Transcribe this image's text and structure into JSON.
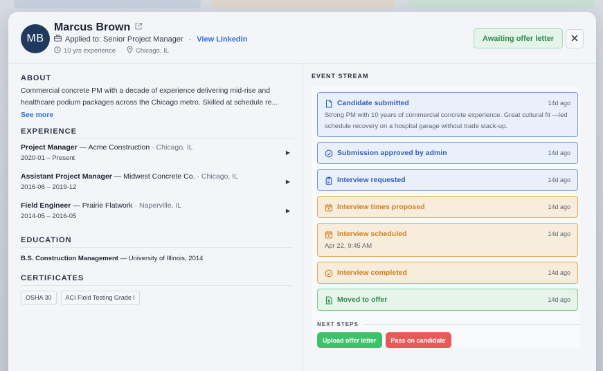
{
  "candidate": {
    "initials": "MB",
    "name": "Marcus Brown",
    "applied_label": "Applied to: Senior Project Manager",
    "linkedin_label": "View LinkedIn",
    "experience_years": "10 yrs experience",
    "location": "Chicago, IL",
    "status": "Awaiting offer letter"
  },
  "close_label": "×",
  "about": {
    "title": "ABOUT",
    "text": "Commercial concrete PM with a decade of experience delivering mid-rise and healthcare podium packages across the Chicago metro. Skilled at schedule re...",
    "see_more": "See more"
  },
  "experience": {
    "title": "EXPERIENCE",
    "items": [
      {
        "role": "Project Manager",
        "company": "Acme Construction",
        "location": "Chicago, IL",
        "dates": "2020-01 – Present"
      },
      {
        "role": "Assistant Project Manager",
        "company": "Midwest Concrete Co.",
        "location": "Chicago, IL",
        "dates": "2016-06 – 2019-12"
      },
      {
        "role": "Field Engineer",
        "company": "Prairie Flatwork",
        "location": "Naperville, IL",
        "dates": "2014-05 – 2016-05"
      }
    ]
  },
  "education": {
    "title": "EDUCATION",
    "degree": "B.S. Construction Management",
    "school": "University of Illinois, 2014"
  },
  "certificates": {
    "title": "CERTIFICATES",
    "items": [
      "OSHA 30",
      "ACI Field Testing Grade I"
    ]
  },
  "event_stream": {
    "title": "EVENT STREAM",
    "events": [
      {
        "title": "Candidate submitted",
        "time": "14d ago",
        "desc": "Strong PM with 10 years of commercial concrete experience. Great cultural fit —led schedule recovery on a hospital garage without trade stack-up.",
        "color": "#2f5fb8",
        "icon": "document-icon"
      },
      {
        "title": "Submission approved by admin",
        "time": "14d ago",
        "color": "#2f5fb8",
        "icon": "check-circle-icon"
      },
      {
        "title": "Interview requested",
        "time": "14d ago",
        "color": "#2f5fb8",
        "icon": "clipboard-icon"
      },
      {
        "title": "Interview times proposed",
        "time": "14d ago",
        "color": "#cf7f1a",
        "icon": "calendar-icon"
      },
      {
        "title": "Interview scheduled",
        "time": "14d ago",
        "desc": "Apr 22, 9:45 AM",
        "color": "#cf7f1a",
        "icon": "calendar-icon"
      },
      {
        "title": "Interview completed",
        "time": "14d ago",
        "color": "#cf7f1a",
        "icon": "check-circle-icon"
      },
      {
        "title": "Moved to offer",
        "time": "14d ago",
        "color": "#2d8a48",
        "icon": "document-dollar-icon"
      }
    ]
  },
  "next_steps": {
    "title": "NEXT STEPS",
    "upload_label": "Upload offer letter",
    "pass_label": "Pass on candidate"
  }
}
